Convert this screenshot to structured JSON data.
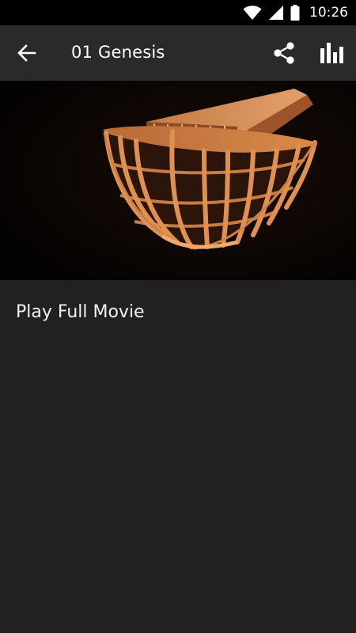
{
  "status_bar": {
    "time": "10:26",
    "icons": [
      "wifi-icon",
      "signal-icon",
      "battery-icon"
    ]
  },
  "app_bar": {
    "title": "01 Genesis",
    "back_icon": "arrow-back-icon",
    "share_icon": "share-icon",
    "stats_icon": "bar-chart-icon"
  },
  "video": {
    "thumbnail": "ark-model-thumbnail"
  },
  "content": {
    "play_full_label": "Play Full Movie"
  },
  "colors": {
    "background": "#212121",
    "app_bar": "#2a2a2a",
    "status_bar": "#000000",
    "wood": "#d98a4a"
  }
}
